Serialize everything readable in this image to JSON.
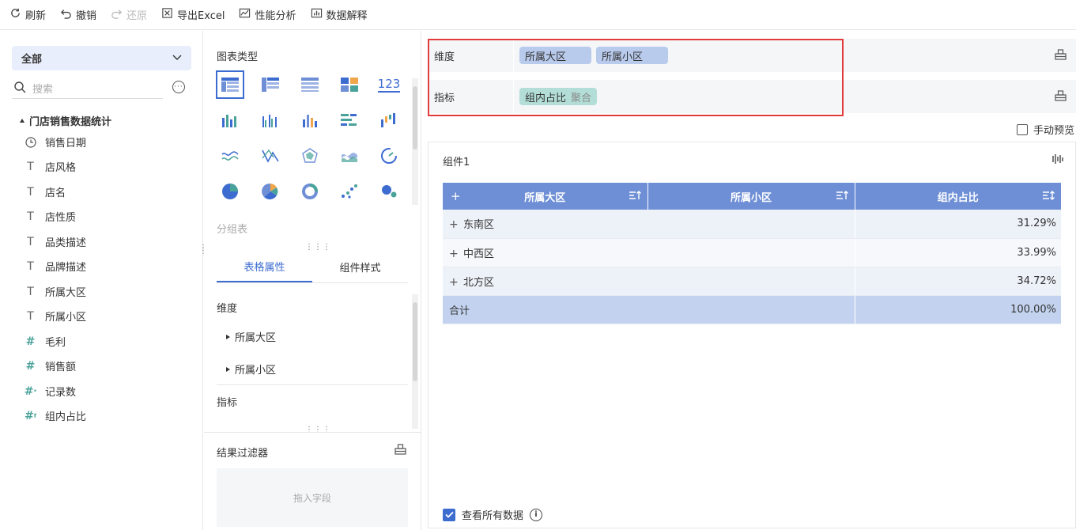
{
  "toolbar": {
    "refresh": "刷新",
    "undo": "撤销",
    "redo": "还原",
    "export": "导出Excel",
    "perf": "性能分析",
    "explain": "数据解释"
  },
  "left": {
    "scope": "全部",
    "search_placeholder": "搜索",
    "dataset": "门店销售数据统计",
    "fields": [
      {
        "label": "销售日期",
        "icon": "calendar-icon"
      },
      {
        "label": "店风格",
        "icon": "text-field-icon"
      },
      {
        "label": "店名",
        "icon": "text-field-icon"
      },
      {
        "label": "店性质",
        "icon": "text-field-icon"
      },
      {
        "label": "品类描述",
        "icon": "text-field-icon"
      },
      {
        "label": "品牌描述",
        "icon": "text-field-icon"
      },
      {
        "label": "所属大区",
        "icon": "text-field-icon"
      },
      {
        "label": "所属小区",
        "icon": "text-field-icon"
      },
      {
        "label": "毛利",
        "icon": "number-field-icon"
      },
      {
        "label": "销售额",
        "icon": "number-field-icon"
      },
      {
        "label": "记录数",
        "icon": "record-count-icon"
      },
      {
        "label": "组内占比",
        "icon": "calculated-field-icon"
      }
    ]
  },
  "mid": {
    "chart_type_title": "图表类型",
    "chart_type_123": "123",
    "group_table": "分组表",
    "tab_table": "表格属性",
    "tab_style": "组件样式",
    "dim_label": "维度",
    "dim_items": [
      "所属大区",
      "所属小区"
    ],
    "measure_label": "指标",
    "filter_title": "结果过滤器",
    "drop_hint": "拖入字段"
  },
  "right": {
    "dim_label": "维度",
    "dim_pills": [
      "所属大区",
      "所属小区"
    ],
    "measure_label": "指标",
    "measure_pill": "组内占比",
    "measure_agg": "聚合",
    "manual_preview": "手动预览",
    "widget_title": "组件1",
    "table": {
      "headers": [
        "所属大区",
        "所属小区",
        "组内占比"
      ],
      "rows": [
        {
          "region": "东南区",
          "sub": "",
          "pct": "31.29%"
        },
        {
          "region": "中西区",
          "sub": "",
          "pct": "33.99%"
        },
        {
          "region": "北方区",
          "sub": "",
          "pct": "34.72%"
        }
      ],
      "total_label": "合计",
      "total_value": "100.00%"
    },
    "view_all": "查看所有数据"
  },
  "colors": {
    "accent": "#3d6cd0",
    "header": "#6e8fd6",
    "dim_pill": "#b9cbed",
    "measure_pill": "#b3ded7",
    "highlight_box": "#e23b3b"
  }
}
